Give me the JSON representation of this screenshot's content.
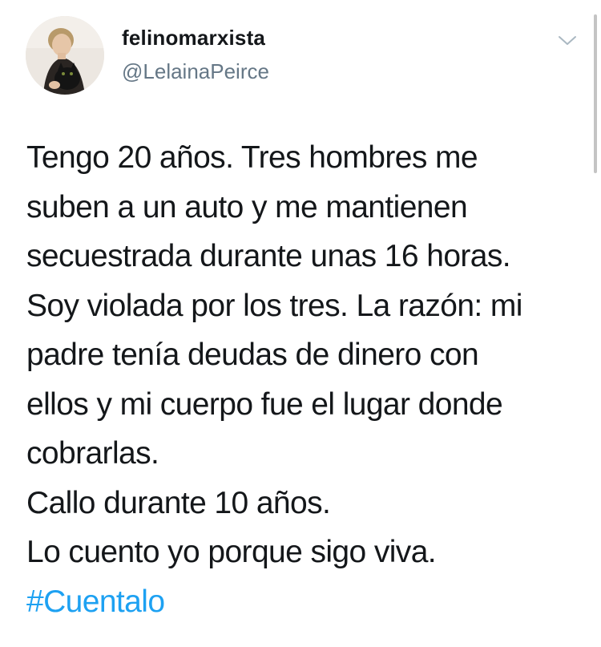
{
  "tweet": {
    "author": {
      "display_name": "felinomarxista",
      "handle": "@LelainaPeirce",
      "avatar_icon": "avatar-photo"
    },
    "menu_icon": "chevron-down-icon",
    "text_lines": [
      "Tengo 20 años. Tres hombres me",
      "suben a un auto y me mantienen",
      "secuestrada durante unas 16 horas.",
      "Soy violada por los tres. La razón: mi",
      "padre tenía deudas de dinero con",
      "ellos y mi cuerpo fue el lugar donde",
      "cobrarlas.",
      "Callo durante 10 años.",
      "Lo cuento yo porque sigo viva."
    ],
    "hashtag": "#Cuentalo"
  },
  "colors": {
    "text": "#14171a",
    "secondary": "#657786",
    "link": "#1da1f2"
  }
}
